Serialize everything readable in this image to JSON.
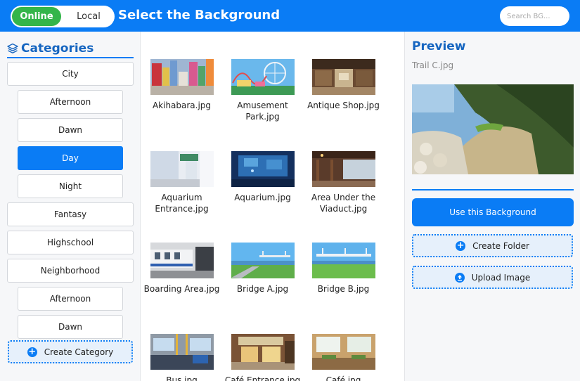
{
  "header": {
    "toggle_online": "Online",
    "toggle_local": "Local",
    "title": "Select the Background",
    "search_placeholder": "Search BG..."
  },
  "sidebar": {
    "title": "Categories",
    "items": [
      {
        "label": "City",
        "level": "top",
        "active": false
      },
      {
        "label": "Afternoon",
        "level": "sub",
        "active": false
      },
      {
        "label": "Dawn",
        "level": "sub",
        "active": false
      },
      {
        "label": "Day",
        "level": "sub",
        "active": true
      },
      {
        "label": "Night",
        "level": "sub",
        "active": false
      },
      {
        "label": "Fantasy",
        "level": "top",
        "active": false
      },
      {
        "label": "Highschool",
        "level": "top",
        "active": false
      },
      {
        "label": "Neighborhood",
        "level": "top",
        "active": false
      },
      {
        "label": "Afternoon",
        "level": "sub",
        "active": false
      },
      {
        "label": "Dawn",
        "level": "sub",
        "active": false
      }
    ],
    "create_label": "Create Category"
  },
  "grid": {
    "files": [
      "Akihabara.jpg",
      "Amusement Park.jpg",
      "Antique Shop.jpg",
      "Aquarium Entrance.jpg",
      "Aquarium.jpg",
      "Area Under the Viaduct.jpg",
      "Boarding Area.jpg",
      "Bridge A.jpg",
      "Bridge B.jpg",
      "Bus.jpg",
      "Café Entrance.jpg",
      "Café.jpg"
    ]
  },
  "preview": {
    "title": "Preview",
    "filename": "Trail C.jpg",
    "use_label": "Use this Background",
    "folder_label": "Create Folder",
    "upload_label": "Upload Image"
  },
  "colors": {
    "accent": "#0a7cf5",
    "online_green": "#34b54a",
    "heading_blue": "#1565c0"
  }
}
